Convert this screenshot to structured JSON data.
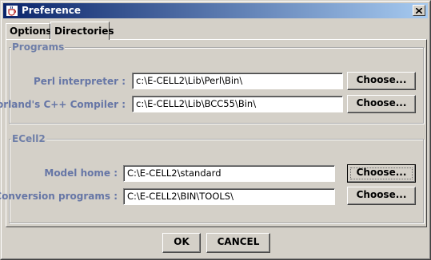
{
  "window": {
    "title": "Preference",
    "icon": "java-coffee-cup-icon"
  },
  "tabs": [
    {
      "label": "Options",
      "selected": false
    },
    {
      "label": "Directories",
      "selected": true
    }
  ],
  "programs": {
    "title": "Programs",
    "rows": [
      {
        "label": "Perl interpreter :",
        "value": "c:\\E-CELL2\\Lib\\Perl\\Bin\\",
        "button": "Choose..."
      },
      {
        "label": "Borland's C++ Compiler :",
        "value": "c:\\E-CELL2\\Lib\\BCC55\\Bin\\",
        "button": "Choose..."
      }
    ]
  },
  "ecell": {
    "title": "ECell2",
    "rows": [
      {
        "label": "Model home :",
        "value": "C:\\E-CELL2\\standard",
        "button": "Choose..."
      },
      {
        "label": "Conversion programs :",
        "value": "C:\\E-CELL2\\BIN\\TOOLS\\",
        "button": "Choose..."
      }
    ]
  },
  "footer": {
    "ok_label": "OK",
    "cancel_label": "CANCEL"
  },
  "colors": {
    "titlebar_start": "#0a246a",
    "titlebar_end": "#a6caf0",
    "label_text": "#6676a6",
    "background": "#d4d0c8"
  }
}
